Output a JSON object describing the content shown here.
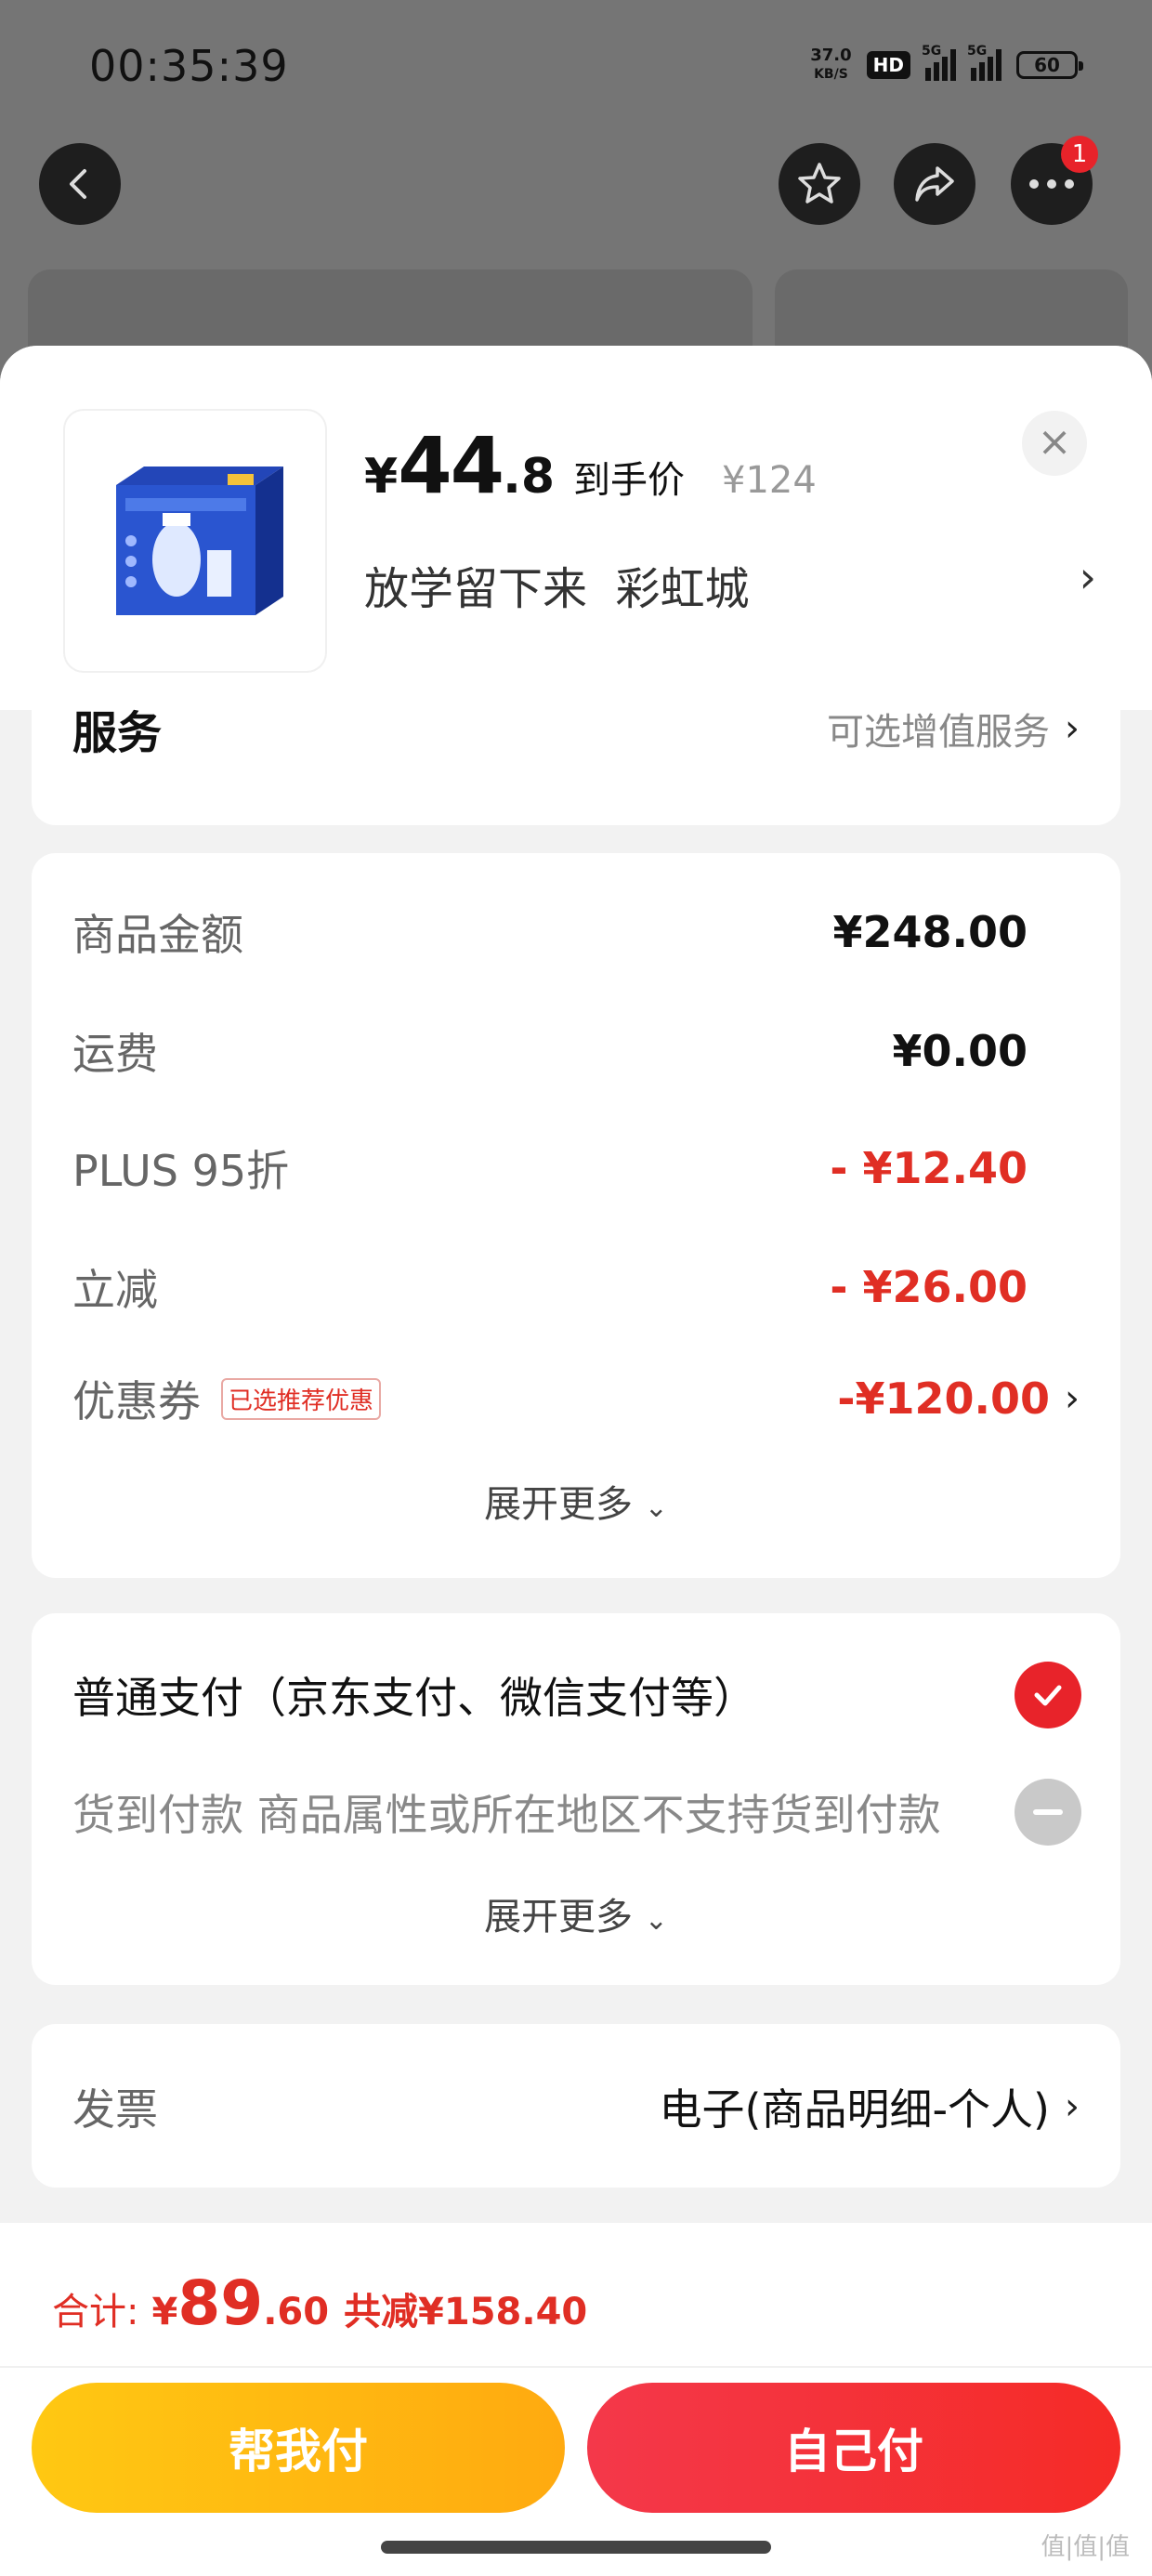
{
  "status_bar": {
    "time": "00:35:39",
    "net_speed_value": "37.0",
    "net_speed_unit": "KB/S",
    "hd_label": "HD",
    "signal_label_1": "5G",
    "signal_label_2": "5G",
    "battery": "60"
  },
  "nav": {
    "notification_count": "1"
  },
  "product": {
    "price_currency": "¥",
    "price_int": "44",
    "price_dec": ".8",
    "price_tag": "到手价",
    "original_price": "¥124",
    "spec": "放学留下来  彩虹城"
  },
  "service": {
    "label": "服务",
    "hint": "可选增值服务"
  },
  "costs": {
    "rows": [
      {
        "label": "商品金额",
        "value": "¥248.00"
      },
      {
        "label": "运费",
        "value": "¥0.00"
      },
      {
        "label": "PLUS 95折",
        "value": "- ¥12.40"
      },
      {
        "label": "立减",
        "value": "- ¥26.00"
      },
      {
        "label": "优惠券",
        "tag": "已选推荐优惠",
        "value": "-¥120.00"
      }
    ],
    "expand": "展开更多"
  },
  "payment": {
    "option_1": "普通支付（京东支付、微信支付等）",
    "option_2": "货到付款 商品属性或所在地区不支持货到付款",
    "expand": "展开更多"
  },
  "invoice": {
    "label": "发票",
    "value": "电子(商品明细-个人)"
  },
  "footer": {
    "total_label": "合计:",
    "total_currency": "¥",
    "total_int": "89",
    "total_dec": ".60",
    "discount": "共减¥158.40",
    "btn_help_pay": "帮我付",
    "btn_self_pay": "自己付"
  },
  "watermark": "值|值|值",
  "colors": {
    "accent_red": "#e02e24",
    "button_yellow": "#ffbb10",
    "button_red": "#f5303c"
  }
}
